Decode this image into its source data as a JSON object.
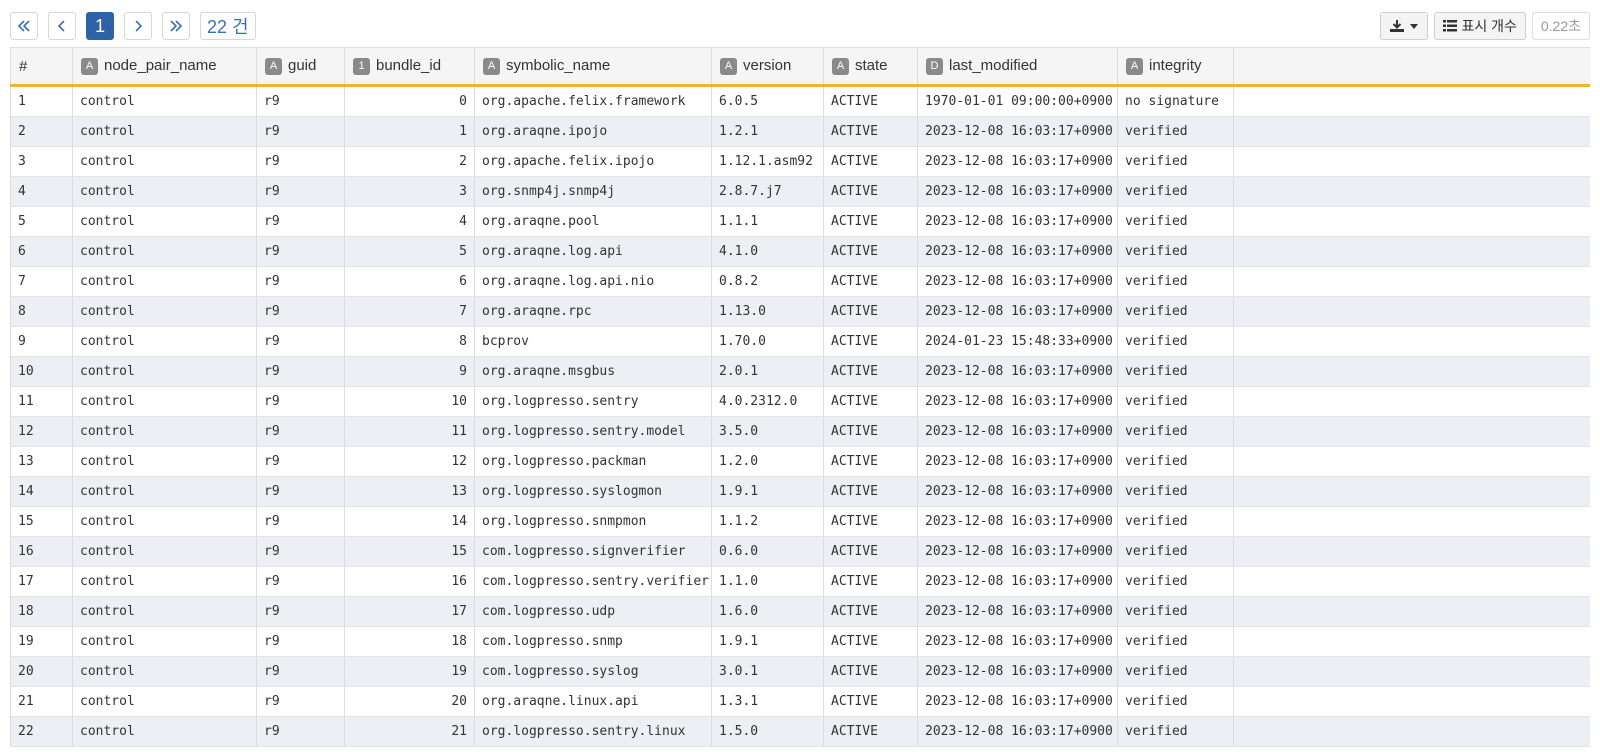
{
  "pager": {
    "first_icon": "double-chevron-left-icon",
    "prev_icon": "chevron-left-icon",
    "current_page": "1",
    "next_icon": "chevron-right-icon",
    "last_icon": "double-chevron-right-icon",
    "total_label": "22 건"
  },
  "tools": {
    "download_icon": "download-icon",
    "columns_label": "표시 개수",
    "elapsed": "0.22초"
  },
  "table": {
    "columns": [
      {
        "label": "#",
        "type": ""
      },
      {
        "label": "node_pair_name",
        "type": "A"
      },
      {
        "label": "guid",
        "type": "A"
      },
      {
        "label": "bundle_id",
        "type": "1"
      },
      {
        "label": "symbolic_name",
        "type": "A"
      },
      {
        "label": "version",
        "type": "A"
      },
      {
        "label": "state",
        "type": "A"
      },
      {
        "label": "last_modified",
        "type": "D"
      },
      {
        "label": "integrity",
        "type": "A"
      }
    ],
    "rows": [
      [
        "1",
        "control",
        "r9",
        "0",
        "org.apache.felix.framework",
        "6.0.5",
        "ACTIVE",
        "1970-01-01 09:00:00+0900",
        "no signature"
      ],
      [
        "2",
        "control",
        "r9",
        "1",
        "org.araqne.ipojo",
        "1.2.1",
        "ACTIVE",
        "2023-12-08 16:03:17+0900",
        "verified"
      ],
      [
        "3",
        "control",
        "r9",
        "2",
        "org.apache.felix.ipojo",
        "1.12.1.asm92",
        "ACTIVE",
        "2023-12-08 16:03:17+0900",
        "verified"
      ],
      [
        "4",
        "control",
        "r9",
        "3",
        "org.snmp4j.snmp4j",
        "2.8.7.j7",
        "ACTIVE",
        "2023-12-08 16:03:17+0900",
        "verified"
      ],
      [
        "5",
        "control",
        "r9",
        "4",
        "org.araqne.pool",
        "1.1.1",
        "ACTIVE",
        "2023-12-08 16:03:17+0900",
        "verified"
      ],
      [
        "6",
        "control",
        "r9",
        "5",
        "org.araqne.log.api",
        "4.1.0",
        "ACTIVE",
        "2023-12-08 16:03:17+0900",
        "verified"
      ],
      [
        "7",
        "control",
        "r9",
        "6",
        "org.araqne.log.api.nio",
        "0.8.2",
        "ACTIVE",
        "2023-12-08 16:03:17+0900",
        "verified"
      ],
      [
        "8",
        "control",
        "r9",
        "7",
        "org.araqne.rpc",
        "1.13.0",
        "ACTIVE",
        "2023-12-08 16:03:17+0900",
        "verified"
      ],
      [
        "9",
        "control",
        "r9",
        "8",
        "bcprov",
        "1.70.0",
        "ACTIVE",
        "2024-01-23 15:48:33+0900",
        "verified"
      ],
      [
        "10",
        "control",
        "r9",
        "9",
        "org.araqne.msgbus",
        "2.0.1",
        "ACTIVE",
        "2023-12-08 16:03:17+0900",
        "verified"
      ],
      [
        "11",
        "control",
        "r9",
        "10",
        "org.logpresso.sentry",
        "4.0.2312.0",
        "ACTIVE",
        "2023-12-08 16:03:17+0900",
        "verified"
      ],
      [
        "12",
        "control",
        "r9",
        "11",
        "org.logpresso.sentry.model",
        "3.5.0",
        "ACTIVE",
        "2023-12-08 16:03:17+0900",
        "verified"
      ],
      [
        "13",
        "control",
        "r9",
        "12",
        "org.logpresso.packman",
        "1.2.0",
        "ACTIVE",
        "2023-12-08 16:03:17+0900",
        "verified"
      ],
      [
        "14",
        "control",
        "r9",
        "13",
        "org.logpresso.syslogmon",
        "1.9.1",
        "ACTIVE",
        "2023-12-08 16:03:17+0900",
        "verified"
      ],
      [
        "15",
        "control",
        "r9",
        "14",
        "org.logpresso.snmpmon",
        "1.1.2",
        "ACTIVE",
        "2023-12-08 16:03:17+0900",
        "verified"
      ],
      [
        "16",
        "control",
        "r9",
        "15",
        "com.logpresso.signverifier",
        "0.6.0",
        "ACTIVE",
        "2023-12-08 16:03:17+0900",
        "verified"
      ],
      [
        "17",
        "control",
        "r9",
        "16",
        "com.logpresso.sentry.verifier",
        "1.1.0",
        "ACTIVE",
        "2023-12-08 16:03:17+0900",
        "verified"
      ],
      [
        "18",
        "control",
        "r9",
        "17",
        "com.logpresso.udp",
        "1.6.0",
        "ACTIVE",
        "2023-12-08 16:03:17+0900",
        "verified"
      ],
      [
        "19",
        "control",
        "r9",
        "18",
        "com.logpresso.snmp",
        "1.9.1",
        "ACTIVE",
        "2023-12-08 16:03:17+0900",
        "verified"
      ],
      [
        "20",
        "control",
        "r9",
        "19",
        "com.logpresso.syslog",
        "3.0.1",
        "ACTIVE",
        "2023-12-08 16:03:17+0900",
        "verified"
      ],
      [
        "21",
        "control",
        "r9",
        "20",
        "org.araqne.linux.api",
        "1.3.1",
        "ACTIVE",
        "2023-12-08 16:03:17+0900",
        "verified"
      ],
      [
        "22",
        "control",
        "r9",
        "21",
        "org.logpresso.sentry.linux",
        "1.5.0",
        "ACTIVE",
        "2023-12-08 16:03:17+0900",
        "verified"
      ]
    ]
  },
  "colors": {
    "accent": "#2f62a6",
    "header_underline": "#f0b429",
    "alt_row": "#eceff3"
  }
}
